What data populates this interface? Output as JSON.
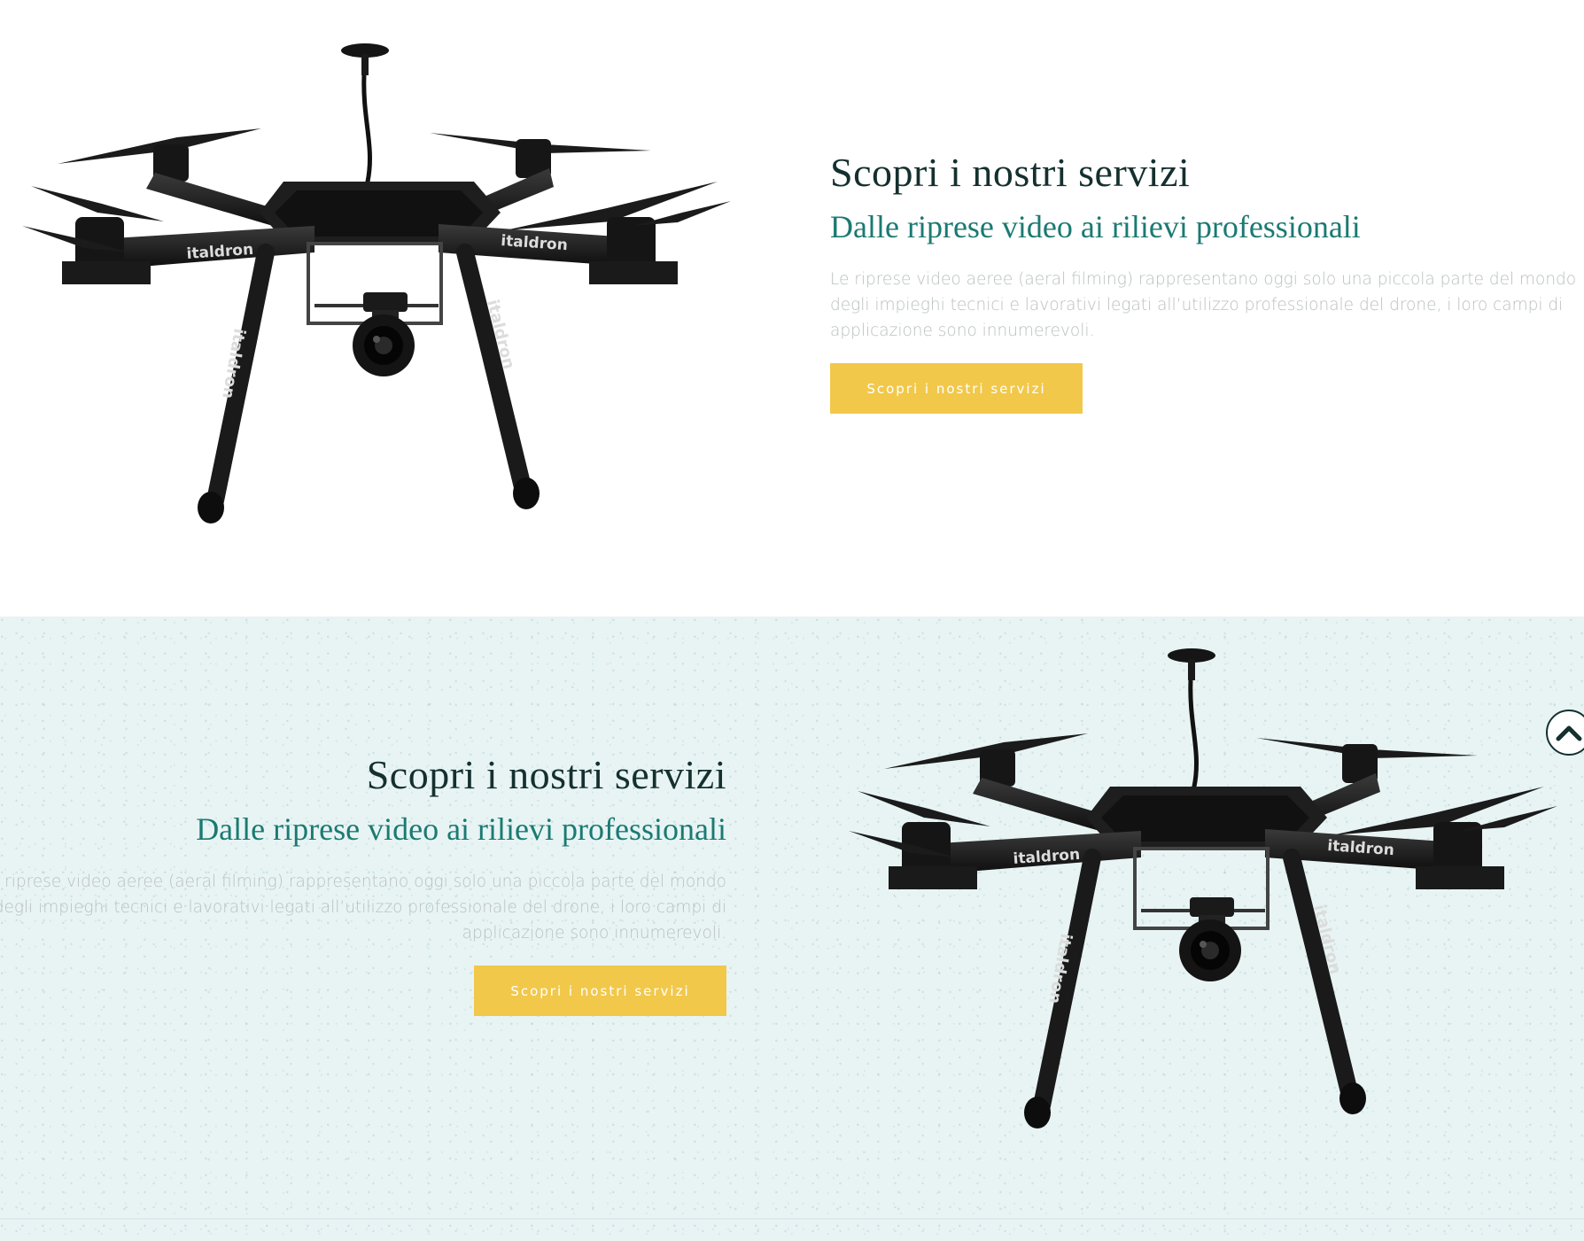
{
  "section_1": {
    "title": "Scopri i nostri servizi",
    "subtitle": "Dalle riprese video ai rilievi professionali",
    "body": "Le riprese video aeree (aeral filming) rappresentano oggi solo una piccola parte del mondo degli impieghi tecnici e lavorativi legati all’utilizzo professionale del drone, i loro campi di applicazione sono innumerevoli.",
    "button_label": "Scopri i nostri servizi"
  },
  "section_2": {
    "title": "Scopri i nostri servizi",
    "subtitle": "Dalle riprese video ai rilievi professionali",
    "body": "Le riprese video aeree (aeral filming) rappresentano oggi solo una piccola parte del mondo degli impieghi tecnici e lavorativi legati all’utilizzo professionale del drone, i loro campi di applicazione sono innumerevoli.",
    "button_label": "Scopri i nostri servizi"
  },
  "drone": {
    "brand_label": "italdron"
  },
  "scroll_top": {
    "icon": "chevron-up-icon"
  },
  "colors": {
    "title": "#14302f",
    "subtitle": "#1b7a72",
    "body": "#b9bfbf",
    "accent": "#f2c84a",
    "band_bg": "#e8f4f4"
  }
}
